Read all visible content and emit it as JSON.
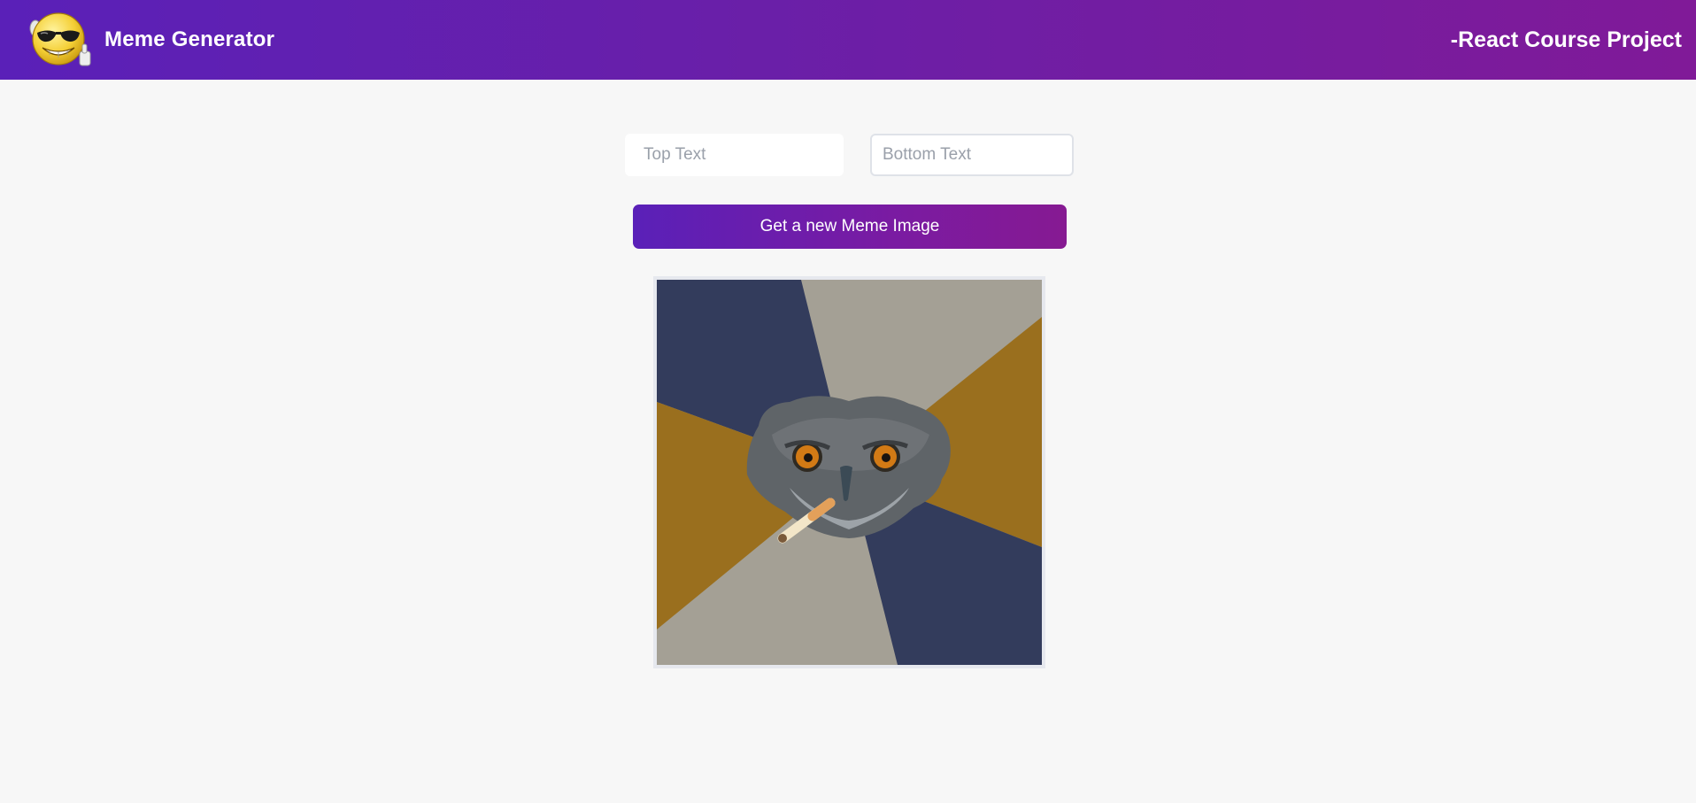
{
  "header": {
    "logo_icon": "sunglasses-smiley-thumbs-up-icon",
    "title": "Meme Generator",
    "project_label": "-React Course Project"
  },
  "form": {
    "top_text": {
      "value": "",
      "placeholder": "Top Text"
    },
    "bottom_text": {
      "value": "",
      "placeholder": "Bottom Text"
    },
    "submit_label": "Get a new Meme Image"
  },
  "meme": {
    "image_icon": "owl-with-cigarette-meme-image"
  },
  "colors": {
    "header_gradient_start": "#5a20b8",
    "header_gradient_end": "#801a98",
    "background": "#f7f7f7",
    "meme_navy": "#333c5c",
    "meme_gold": "#9a6f1e",
    "meme_gray": "#a4a095"
  }
}
